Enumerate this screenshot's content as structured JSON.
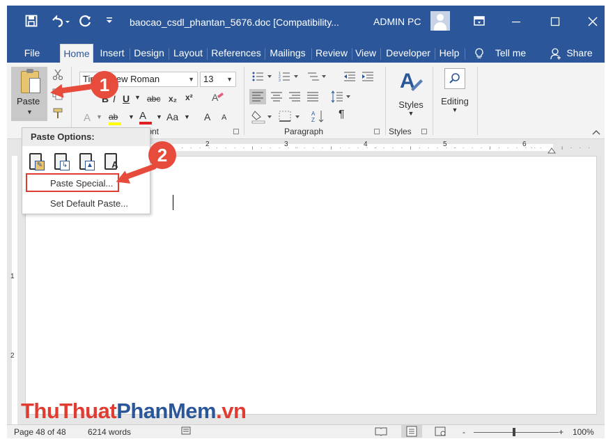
{
  "title_bar": {
    "doc_title": "baocao_csdl_phantan_5676.doc [Compatibility...",
    "user_name": "ADMIN PC"
  },
  "ribbon_tabs": [
    "File",
    "Home",
    "Insert",
    "Design",
    "Layout",
    "References",
    "Mailings",
    "Review",
    "View",
    "Developer",
    "Help"
  ],
  "active_tab": "Home",
  "tell_me": "Tell me",
  "share": "Share",
  "clipboard": {
    "paste_label": "Paste"
  },
  "font": {
    "font_name": "Times New Roman",
    "font_size": "13",
    "group_label": "Font",
    "bold": "B",
    "italic": "I",
    "underline": "U",
    "strike": "abc",
    "subscript": "x₂",
    "superscript": "x²",
    "clear_format": "A",
    "text_effects": "A",
    "highlight": "ab",
    "font_color": "A",
    "change_case": "Aa",
    "grow": "A",
    "shrink": "A"
  },
  "paragraph": {
    "group_label": "Paragraph",
    "show_marks": "¶"
  },
  "styles": {
    "label": "Styles",
    "group_label": "Styles"
  },
  "editing": {
    "label": "Editing"
  },
  "ruler": {
    "numbers": [
      "2",
      "3",
      "4",
      "5",
      "6"
    ],
    "vertical_numbers": [
      "1",
      "2"
    ]
  },
  "paste_menu": {
    "header": "Paste Options:",
    "item_special": "Paste Special...",
    "item_default": "Set Default Paste..."
  },
  "callouts": {
    "one": "1",
    "two": "2"
  },
  "status_bar": {
    "page": "Page 48 of 48",
    "words": "6214 words",
    "zoom_minus": "-",
    "zoom_plus": "+",
    "zoom": "100%"
  },
  "watermark": {
    "part1": "ThuThuat",
    "part2": "PhanMem",
    "part3": ".vn"
  },
  "colors": {
    "title_bar": "#2b579a",
    "callout_red": "#e64b3c",
    "watermark_red": "#e03c31",
    "watermark_blue": "#2b579a"
  }
}
